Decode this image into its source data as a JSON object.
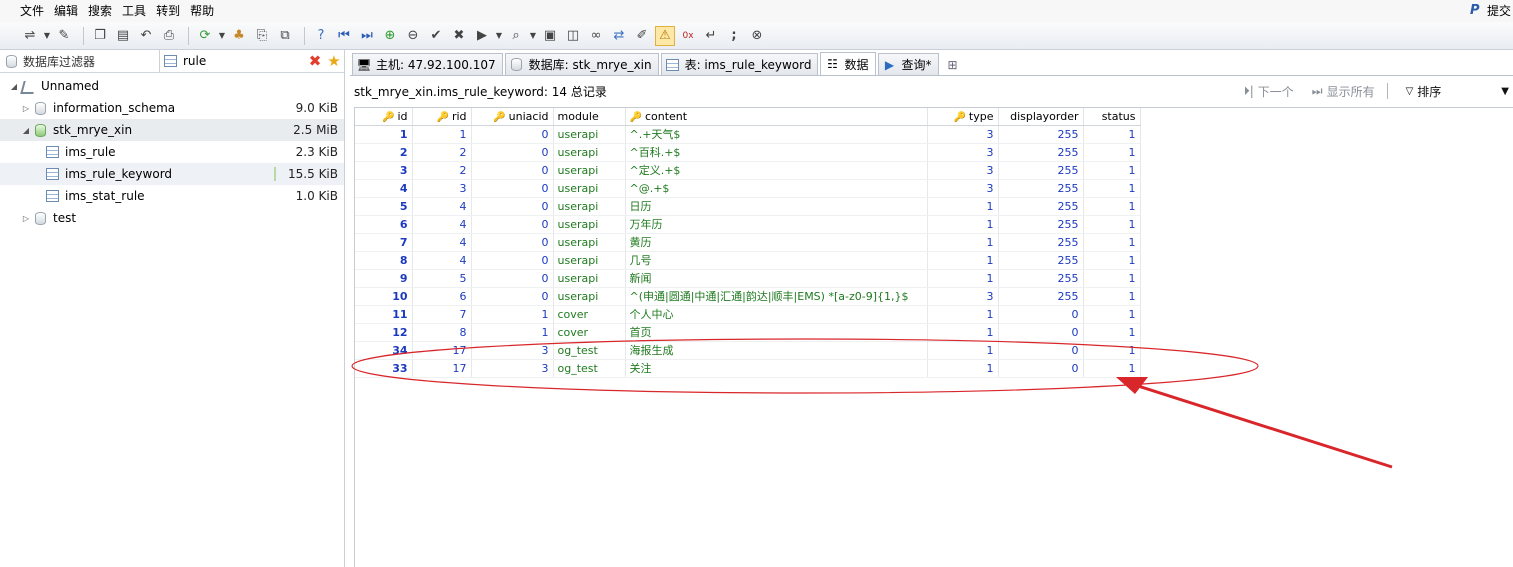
{
  "menu": {
    "items": [
      "文件",
      "编辑",
      "搜索",
      "工具",
      "转到",
      "帮助"
    ],
    "submit_label": "提交"
  },
  "toolbar": {
    "icons": [
      "connect-icon",
      "disconnect-icon",
      "copy-icon",
      "paste-icon",
      "undo-icon",
      "print-icon",
      "refresh-icon",
      "user-manager-icon",
      "export-icon",
      "import-icon",
      "help-icon",
      "first-icon",
      "last-icon",
      "add-row-icon",
      "delete-row-icon",
      "save-check-icon",
      "cancel-icon",
      "execute-icon",
      "query-icon",
      "save-icon",
      "save-as-icon",
      "binoculars-icon",
      "replace-icon",
      "edit-icon",
      "warning-icon",
      "hex-icon",
      "wrap-icon",
      "semicolon-icon",
      "stop-icon"
    ]
  },
  "left": {
    "filter_db_placeholder": "数据库过滤器",
    "filter_table_value": "rule",
    "tree": [
      {
        "label": "Unnamed",
        "size": "",
        "level": 0,
        "icon": "server-icon",
        "expanded": true
      },
      {
        "label": "information_schema",
        "size": "9.0 KiB",
        "level": 1,
        "icon": "database-icon",
        "expanded": false
      },
      {
        "label": "stk_mrye_xin",
        "size": "2.5 MiB",
        "level": 1,
        "icon": "database-active-icon",
        "expanded": true
      },
      {
        "label": "ims_rule",
        "size": "2.3 KiB",
        "level": 2,
        "icon": "table-icon"
      },
      {
        "label": "ims_rule_keyword",
        "size": "15.5 KiB",
        "level": 2,
        "icon": "table-icon",
        "selected": true
      },
      {
        "label": "ims_stat_rule",
        "size": "1.0 KiB",
        "level": 2,
        "icon": "table-icon"
      },
      {
        "label": "test",
        "size": "",
        "level": 1,
        "icon": "database-icon",
        "expanded": false
      }
    ]
  },
  "tabs": [
    {
      "label": "主机: 47.92.100.107",
      "icon": "host-icon"
    },
    {
      "label": "数据库: stk_mrye_xin",
      "icon": "database-icon"
    },
    {
      "label": "表: ims_rule_keyword",
      "icon": "table-icon"
    },
    {
      "label": "数据",
      "icon": "data-icon",
      "active": true
    },
    {
      "label": "查询*",
      "icon": "query-play-icon"
    }
  ],
  "info": {
    "record_text": "stk_mrye_xin.ims_rule_keyword: 14 总记录",
    "next_label": "下一个",
    "show_all_label": "显示所有",
    "sort_label": "排序"
  },
  "grid": {
    "columns": [
      {
        "label": "id",
        "key": true
      },
      {
        "label": "rid",
        "key": true
      },
      {
        "label": "uniacid",
        "key": true
      },
      {
        "label": "module",
        "key": false
      },
      {
        "label": "content",
        "key": true
      },
      {
        "label": "type",
        "key": true
      },
      {
        "label": "displayorder",
        "key": false
      },
      {
        "label": "status",
        "key": false
      }
    ],
    "rows": [
      [
        "1",
        "1",
        "0",
        "userapi",
        "^.+天气$",
        "3",
        "255",
        "1"
      ],
      [
        "2",
        "2",
        "0",
        "userapi",
        "^百科.+$",
        "3",
        "255",
        "1"
      ],
      [
        "3",
        "2",
        "0",
        "userapi",
        "^定义.+$",
        "3",
        "255",
        "1"
      ],
      [
        "4",
        "3",
        "0",
        "userapi",
        "^@.+$",
        "3",
        "255",
        "1"
      ],
      [
        "5",
        "4",
        "0",
        "userapi",
        "日历",
        "1",
        "255",
        "1"
      ],
      [
        "6",
        "4",
        "0",
        "userapi",
        "万年历",
        "1",
        "255",
        "1"
      ],
      [
        "7",
        "4",
        "0",
        "userapi",
        "黄历",
        "1",
        "255",
        "1"
      ],
      [
        "8",
        "4",
        "0",
        "userapi",
        "几号",
        "1",
        "255",
        "1"
      ],
      [
        "9",
        "5",
        "0",
        "userapi",
        "新闻",
        "1",
        "255",
        "1"
      ],
      [
        "10",
        "6",
        "0",
        "userapi",
        "^(申通|圆通|中通|汇通|韵达|顺丰|EMS) *[a-z0-9]{1,}$",
        "3",
        "255",
        "1"
      ],
      [
        "11",
        "7",
        "1",
        "cover",
        "个人中心",
        "1",
        "0",
        "1"
      ],
      [
        "12",
        "8",
        "1",
        "cover",
        "首页",
        "1",
        "0",
        "1"
      ],
      [
        "34",
        "17",
        "3",
        "og_test",
        "海报生成",
        "1",
        "0",
        "1"
      ],
      [
        "33",
        "17",
        "3",
        "og_test",
        "关注",
        "1",
        "0",
        "1"
      ]
    ]
  },
  "annotation": {
    "color": "#d9262a"
  }
}
